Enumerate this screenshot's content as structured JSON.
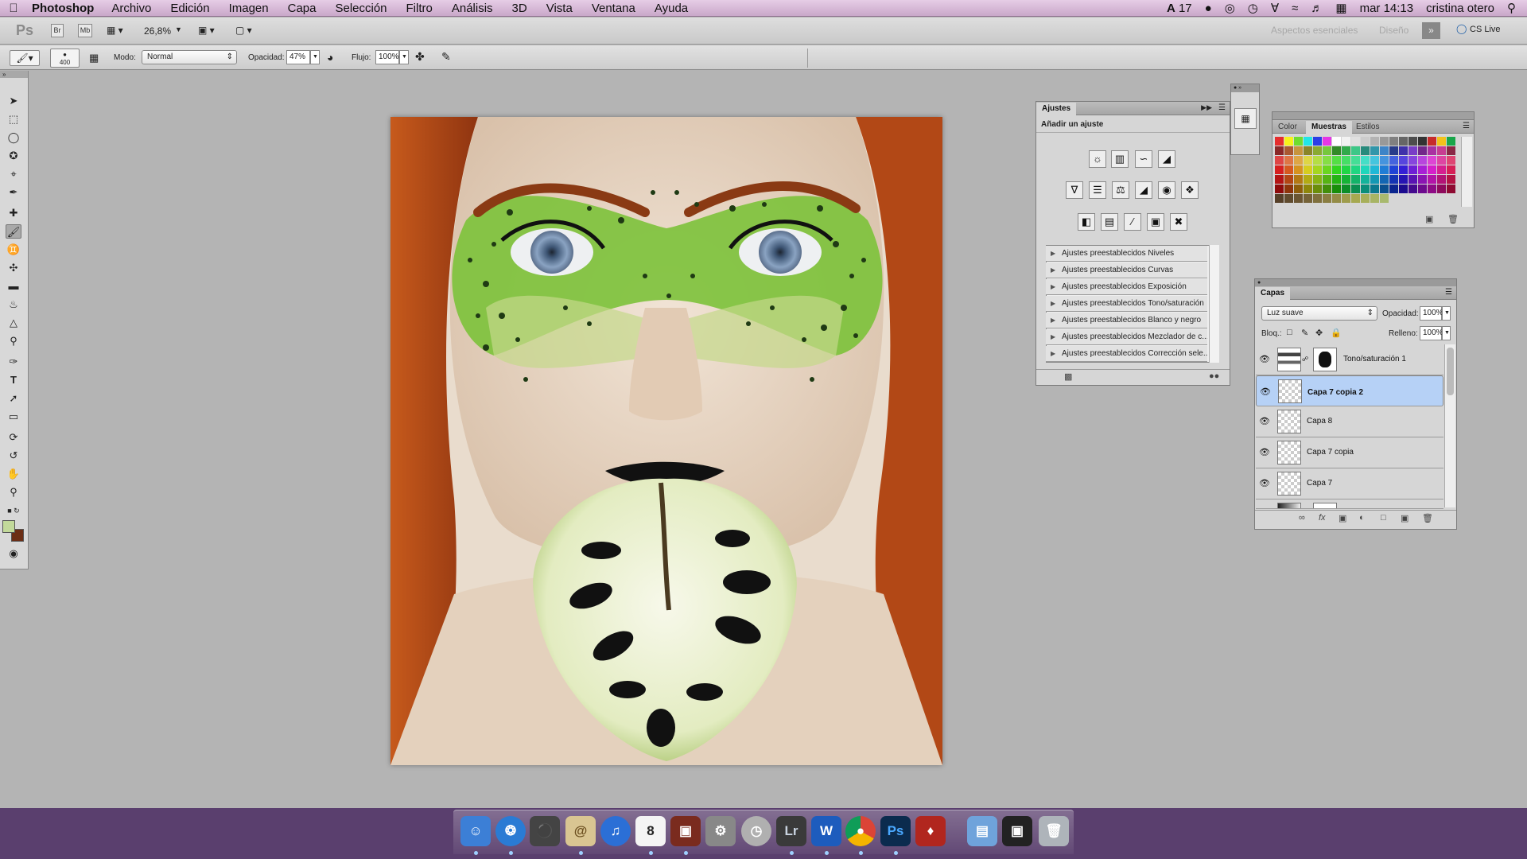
{
  "menubar": {
    "app": "Photoshop",
    "items": [
      "Archivo",
      "Edición",
      "Imagen",
      "Capa",
      "Selección",
      "Filtro",
      "Análisis",
      "3D",
      "Vista",
      "Ventana",
      "Ayuda"
    ],
    "status_badge": "17",
    "clock": "mar 14:13",
    "user": "cristina otero"
  },
  "appbar": {
    "ps_logo": "Ps",
    "bridge": "Br",
    "minibridge": "Mb",
    "zoom": "26,8%",
    "workspace_essentials": "Aspectos esenciales",
    "workspace_design": "Diseño",
    "cs_live": "CS Live"
  },
  "options": {
    "brush_size": "400",
    "mode_label": "Modo:",
    "mode_value": "Normal",
    "opacity_label": "Opacidad:",
    "opacity_value": "47%",
    "flow_label": "Flujo:",
    "flow_value": "100%"
  },
  "colors": {
    "foreground": "#c2d99a",
    "background": "#6b2d14"
  },
  "adjustments": {
    "tab": "Ajustes",
    "heading": "Añadir un ajuste",
    "presets": [
      "Ajustes preestablecidos Niveles",
      "Ajustes preestablecidos Curvas",
      "Ajustes preestablecidos Exposición",
      "Ajustes preestablecidos Tono/saturación",
      "Ajustes preestablecidos Blanco y negro",
      "Ajustes preestablecidos Mezclador de c...",
      "Ajustes preestablecidos Corrección sele..."
    ]
  },
  "swatches_panel": {
    "tabs": [
      "Color",
      "Muestras",
      "Estilos"
    ],
    "active": "Muestras"
  },
  "layers_panel": {
    "tab": "Capas",
    "blend_mode": "Luz suave",
    "opacity_label": "Opacidad:",
    "opacity_value": "100%",
    "lock_label": "Bloq.:",
    "fill_label": "Relleno:",
    "fill_value": "100%",
    "layers": [
      {
        "name": "Tono/saturación 1",
        "selected": false
      },
      {
        "name": "Capa 7 copia 2",
        "selected": true
      },
      {
        "name": "Capa 8",
        "selected": false
      },
      {
        "name": "Capa 7 copia",
        "selected": false
      },
      {
        "name": "Capa 7",
        "selected": false
      }
    ]
  },
  "dock": {
    "lightroom": "Lr",
    "photoshop": "Ps",
    "calendar_day": "8"
  }
}
